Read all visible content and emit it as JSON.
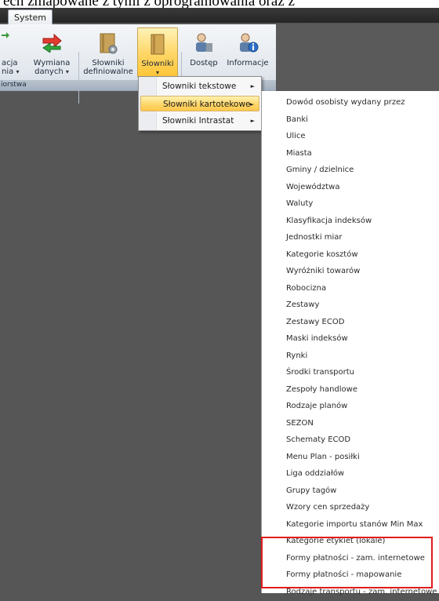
{
  "caption": "ech zmapowane z tymi z oprogramowania oraz z",
  "tab": "System",
  "ribbon": {
    "btn_akcja_1": "acja",
    "btn_akcja_2": "nia",
    "btn_wymiana_1": "Wymiana",
    "btn_wymiana_2": "danych",
    "btn_slowniki_def_1": "Słowniki",
    "btn_slowniki_def_2": "definiowalne",
    "btn_slowniki": "Słowniki",
    "btn_dostep": "Dostęp",
    "btn_informacje": "Informacje",
    "group_label": "iorstwa",
    "dropdown_glyph": "▾"
  },
  "menu1": {
    "items": [
      "Słowniki tekstowe",
      "Słowniki kartotekowe",
      "Słowniki Intrastat"
    ],
    "arrow": "►"
  },
  "menu2": {
    "items": [
      "Dowód osobisty wydany przez",
      "Banki",
      "Ulice",
      "Miasta",
      "Gminy / dzielnice",
      "Województwa",
      "Waluty",
      "Klasyfikacja indeksów",
      "Jednostki miar",
      "Kategorie kosztów",
      "Wyróżniki towarów",
      "Robocizna",
      "Zestawy",
      "Zestawy ECOD",
      "Maski indeksów",
      "Rynki",
      "Środki transportu",
      "Zespoły handlowe",
      "Rodzaje planów",
      "SEZON",
      "Schematy ECOD",
      "Menu Plan - posiłki",
      "Liga oddziałów",
      "Grupy tagów",
      "Wzory cen sprzedaży",
      "Kategorie importu stanów Min Max",
      "Kategorie etykiet (lokale)",
      "Formy płatności - zam. internetowe",
      "Formy płatności - mapowanie",
      "Rodzaje transportu - zam. internetowe"
    ]
  }
}
